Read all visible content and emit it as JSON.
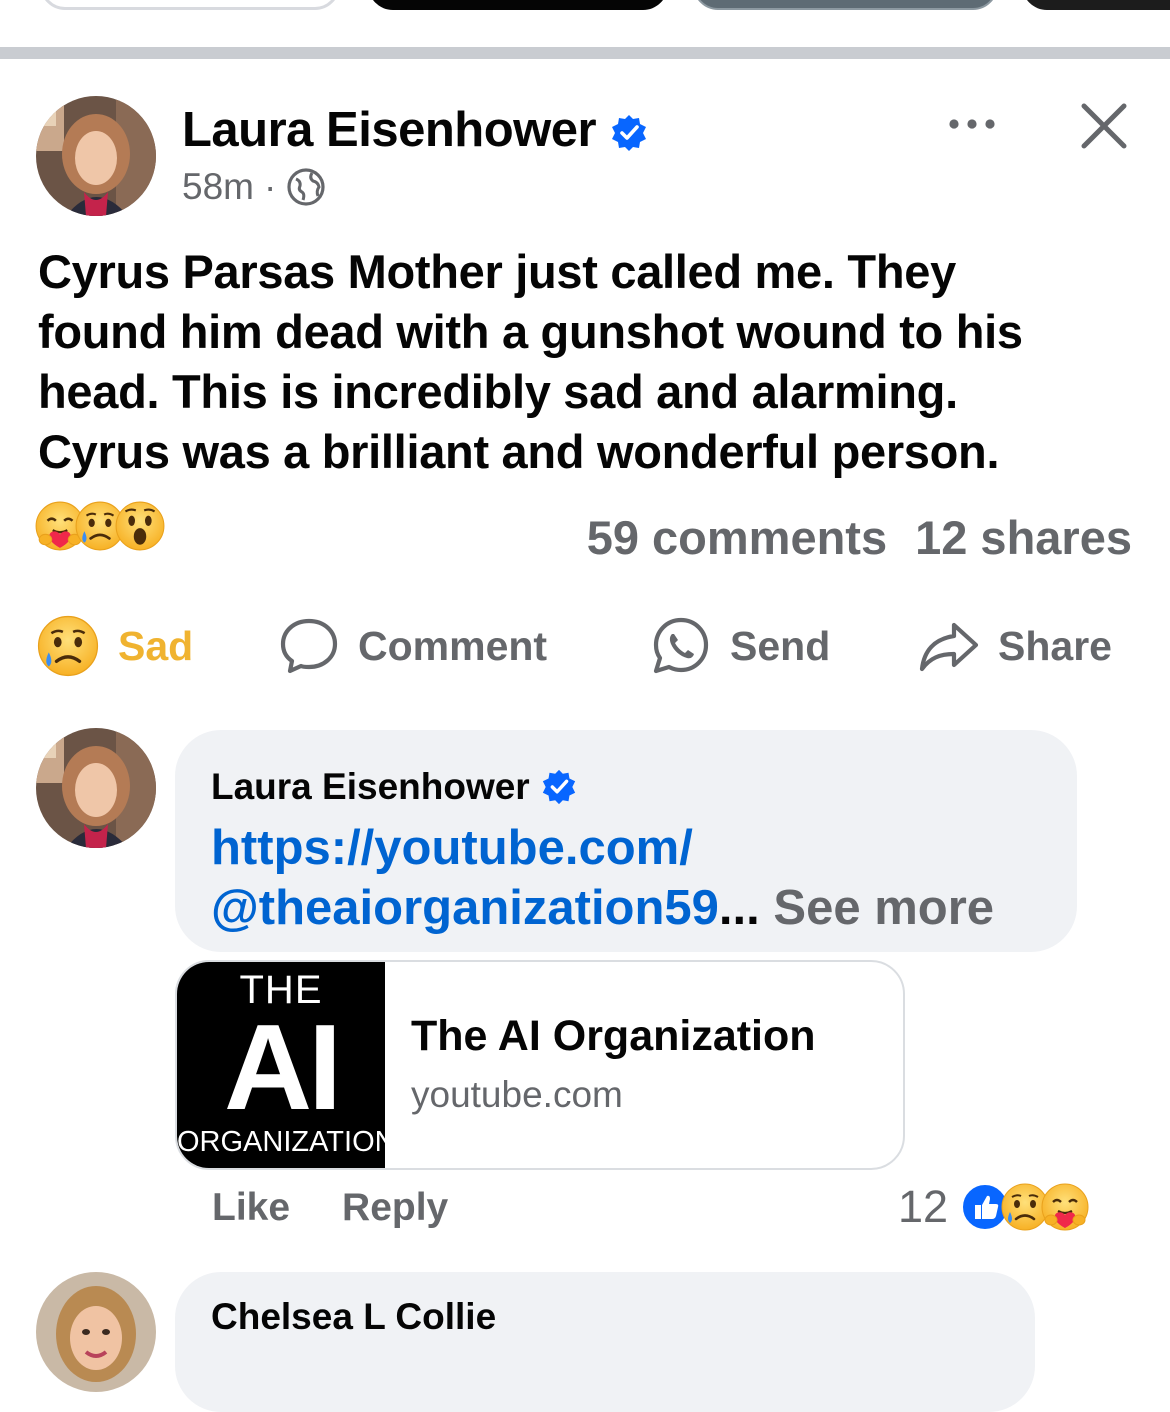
{
  "post": {
    "author": "Laura Eisenhower",
    "time": "58m",
    "separator": "·",
    "text": "Cyrus Parsas Mother just called me.  They\nfound him dead with a gunshot wound to his\nhead.  This is incredibly sad and alarming.\nCyrus was a brilliant and wonderful person.",
    "reactions": [
      "care-emoji",
      "sad-emoji",
      "wow-emoji"
    ],
    "comments_count": "59 comments",
    "shares_count": "12 shares"
  },
  "actions": {
    "sad": "Sad",
    "comment": "Comment",
    "send": "Send",
    "share": "Share"
  },
  "comments": [
    {
      "author": "Laura Eisenhower",
      "link_line1": "https://youtube.com/",
      "link_line2": "@theaiorganization59",
      "ellipsis": "...",
      "see_more": "See more",
      "card": {
        "thumb_top": "THE",
        "thumb_mid": "AI",
        "thumb_bottom": "ORGANIZATION",
        "title": "The AI Organization",
        "domain": "youtube.com"
      },
      "like": "Like",
      "reply": "Reply",
      "reaction_count": "12",
      "reactions": [
        "like-emoji",
        "sad-emoji",
        "care-emoji"
      ]
    },
    {
      "author": "Chelsea L Collie"
    }
  ],
  "colors": {
    "accent_blue": "#0866ff",
    "link_blue": "#0064d1",
    "secondary_text": "#65676b",
    "sad_yellow": "#f0b330",
    "bubble_bg": "#f0f2f5"
  }
}
